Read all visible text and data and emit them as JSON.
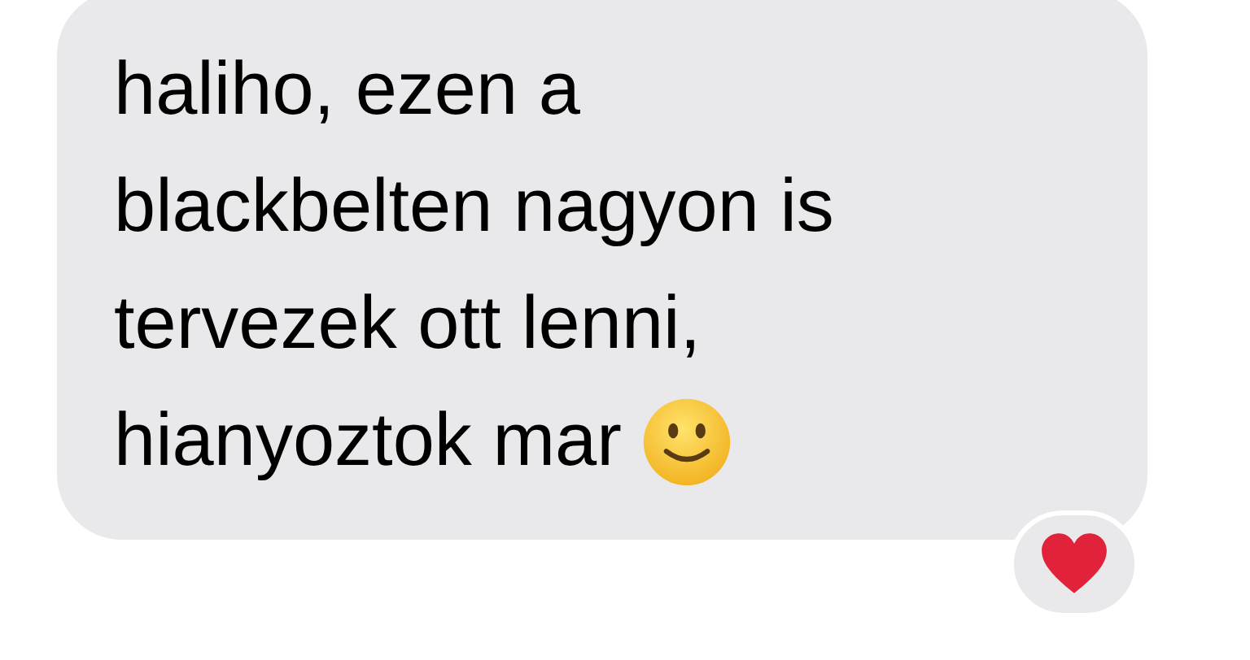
{
  "message": {
    "lines": [
      "haliho, ezen a",
      "blackbelten nagyon is",
      "tervezek ott lenni,",
      "hianyoztok mar"
    ]
  },
  "reaction": {
    "kind": "heart"
  }
}
